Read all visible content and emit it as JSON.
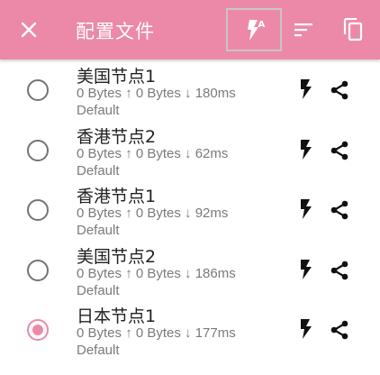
{
  "toolbar": {
    "title": "配置文件",
    "close_icon": "close-icon",
    "test_icon": "lightning-auto-icon",
    "test_icon_badge": "A",
    "sort_icon": "sort-icon",
    "copy_icon": "copy-icon",
    "background_color": "#ec89a8",
    "test_border_color": "#c7c7c7"
  },
  "profiles": [
    {
      "name": "美国节点1",
      "stats": "0 Bytes ↑  0 Bytes ↓  180ms",
      "group": "Default",
      "selected": false
    },
    {
      "name": "香港节点2",
      "stats": "0 Bytes ↑  0 Bytes ↓  62ms",
      "group": "Default",
      "selected": false
    },
    {
      "name": "香港节点1",
      "stats": "0 Bytes ↑  0 Bytes ↓  92ms",
      "group": "Default",
      "selected": false
    },
    {
      "name": "美国节点2",
      "stats": "0 Bytes ↑  0 Bytes ↓  186ms",
      "group": "Default",
      "selected": false
    },
    {
      "name": "日本节点1",
      "stats": "0 Bytes ↑  0 Bytes ↓  177ms",
      "group": "Default",
      "selected": true
    }
  ],
  "row_icons": {
    "test": "lightning-icon",
    "share": "share-icon"
  },
  "colors": {
    "accent": "#ec89a8",
    "text_primary": "#212121",
    "text_secondary": "#7a7a7a"
  }
}
